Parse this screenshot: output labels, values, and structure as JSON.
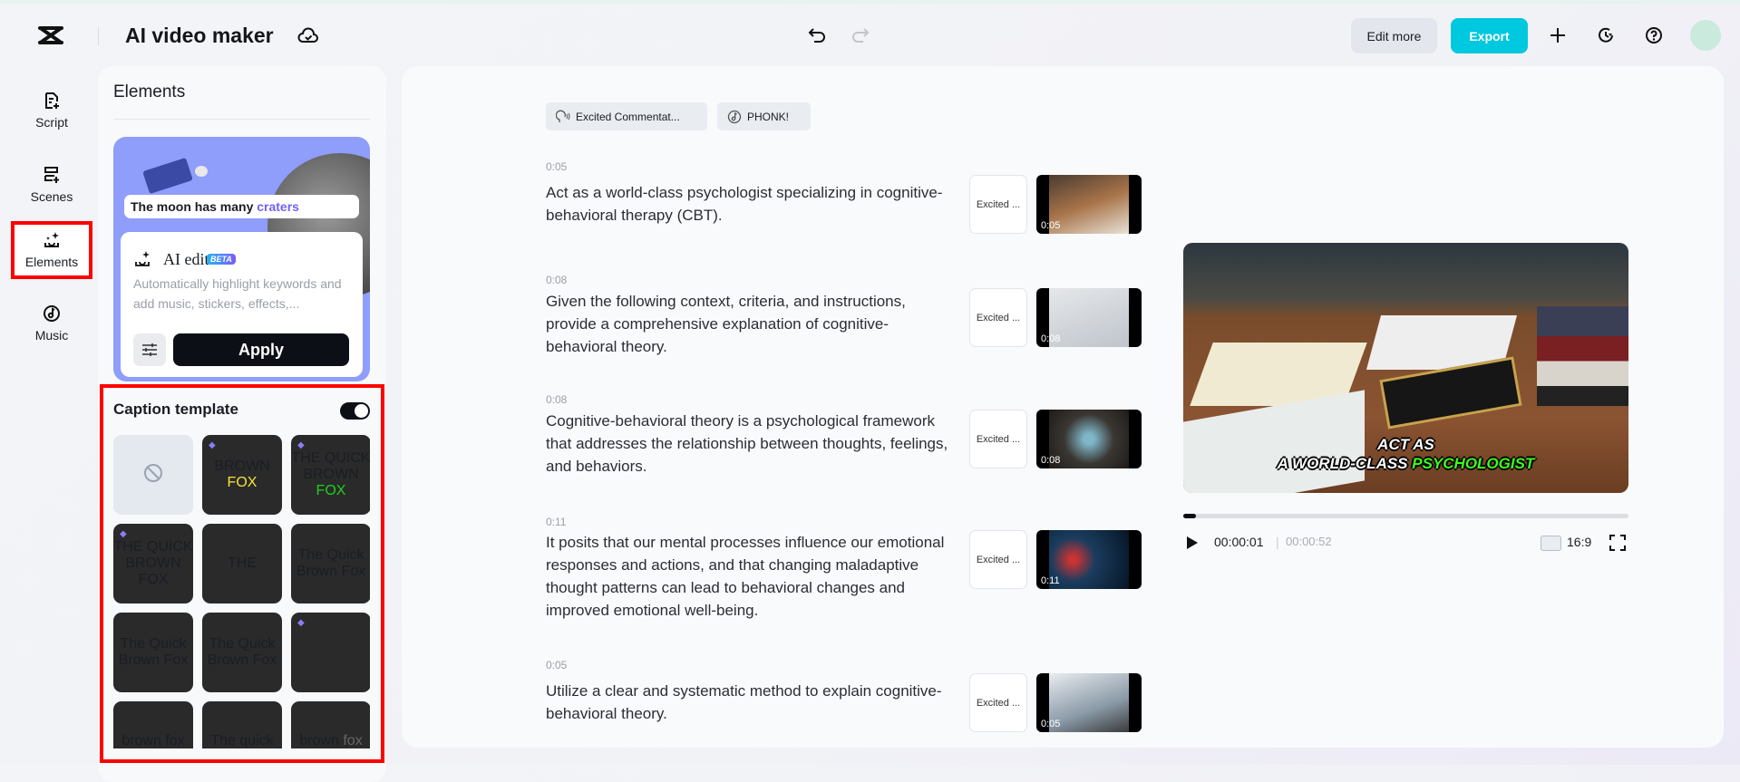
{
  "header": {
    "title": "AI video maker",
    "edit_more": "Edit more",
    "export": "Export"
  },
  "nav": [
    {
      "label": "Script"
    },
    {
      "label": "Scenes"
    },
    {
      "label": "Elements"
    },
    {
      "label": "Music"
    }
  ],
  "elements_panel": {
    "title": "Elements",
    "promo_caption_prefix": "The moon has many ",
    "promo_caption_highlight": "craters",
    "ai_edit": {
      "title": "AI edit",
      "badge": "BETA",
      "description": "Automatically highlight keywords and add music, stickers, effects,...",
      "apply": "Apply"
    },
    "caption_template": {
      "title": "Caption template",
      "enabled": true,
      "tiles": [
        {
          "text": "",
          "none": true
        },
        {
          "text": "BROWN",
          "hl": "FOX",
          "premium": true,
          "style": "t1"
        },
        {
          "text": "THE QUICK BROWN",
          "hl": "FOX",
          "premium": true,
          "style": "t2"
        },
        {
          "text": "THE QUICK BROWN FOX",
          "hl": "",
          "premium": true,
          "style": "t3"
        },
        {
          "text": "THE",
          "hl": "",
          "premium": false,
          "style": "t4"
        },
        {
          "text": "The Quick Brown Fox",
          "hl": "",
          "premium": false,
          "style": "t5"
        },
        {
          "text": "The Quick Brown Fox",
          "hl": "",
          "premium": false,
          "style": "t6"
        },
        {
          "text": "The Quick Brown Fox",
          "hl": "",
          "premium": false,
          "style": "t7"
        },
        {
          "text": "",
          "hl": "",
          "premium": true,
          "style": "t8"
        },
        {
          "text": "brown fox",
          "hl": "",
          "premium": false,
          "style": "t9"
        },
        {
          "text": "The quick",
          "hl": "",
          "premium": false,
          "style": "t10"
        },
        {
          "text": "brown",
          "hl": "fox",
          "premium": false,
          "style": "t11"
        }
      ]
    }
  },
  "script": {
    "voice_chip": "Excited Commentat...",
    "music_chip": "PHONK!",
    "scenes": [
      {
        "time": "0:05",
        "text": "Act as a world-class psychologist specializing in cognitive-behavioral therapy (CBT).",
        "voice": "Excited ...",
        "duration": "0:05"
      },
      {
        "time": "0:08",
        "text": "Given the following context, criteria, and instructions, provide a comprehensive explanation of cognitive-behavioral theory.",
        "voice": "Excited ...",
        "duration": "0:08"
      },
      {
        "time": "0:08",
        "text": "Cognitive-behavioral theory is a psychological framework that addresses the relationship between thoughts, feelings, and behaviors.",
        "voice": "Excited ...",
        "duration": "0:08"
      },
      {
        "time": "0:11",
        "text": "It posits that our mental processes influence our emotional responses and actions, and that changing maladaptive thought patterns can lead to behavioral changes and improved emotional well-being.",
        "voice": "Excited ...",
        "duration": "0:11"
      },
      {
        "time": "0:05",
        "text": "Utilize a clear and systematic method to explain cognitive-behavioral theory.",
        "voice": "Excited ...",
        "duration": "0:05"
      }
    ]
  },
  "preview": {
    "caption_line1": "ACT AS",
    "caption_line2": "A WORLD-CLASS ",
    "caption_highlight": "PSYCHOLOGIST",
    "current_time": "00:00:01",
    "total_time": "00:00:52",
    "progress": 0.02,
    "aspect_ratio": "16:9"
  }
}
